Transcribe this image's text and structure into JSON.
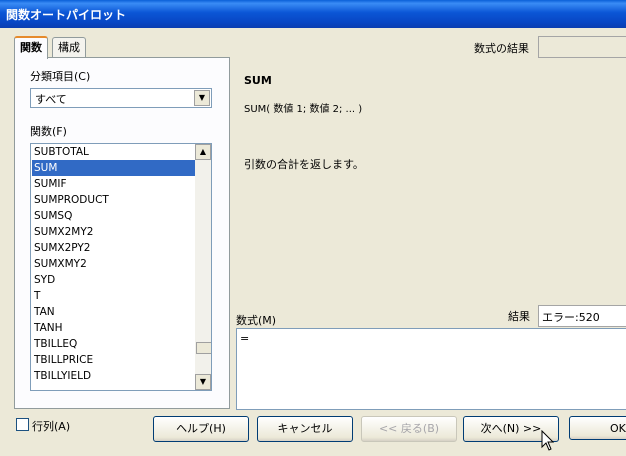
{
  "window": {
    "title": "関数オートパイロット"
  },
  "tabs": [
    {
      "label": "関数",
      "active": true
    },
    {
      "label": "構成",
      "active": false
    }
  ],
  "left": {
    "category_label": "分類項目(C)",
    "category_value": "すべて",
    "function_label": "関数(F)",
    "functions": [
      "SUBTOTAL",
      "SUM",
      "SUMIF",
      "SUMPRODUCT",
      "SUMSQ",
      "SUMX2MY2",
      "SUMX2PY2",
      "SUMXMY2",
      "SYD",
      "T",
      "TAN",
      "TANH",
      "TBILLEQ",
      "TBILLPRICE",
      "TBILLYIELD"
    ],
    "selected_index": 1
  },
  "right": {
    "formula_result_label": "数式の結果",
    "func_name": "SUM",
    "func_syntax": "SUM( 数値 1; 数値 2; ... )",
    "func_description": "引数の合計を返します。",
    "formula_label": "数式(M)",
    "result_label": "結果",
    "result_value": "エラー:520",
    "formula_text": "="
  },
  "footer": {
    "array_label": "行列(A)",
    "help": "ヘルプ(H)",
    "cancel": "キャンセル",
    "back": "<< 戻る(B)",
    "next": "次へ(N) >>",
    "ok": "OK"
  }
}
